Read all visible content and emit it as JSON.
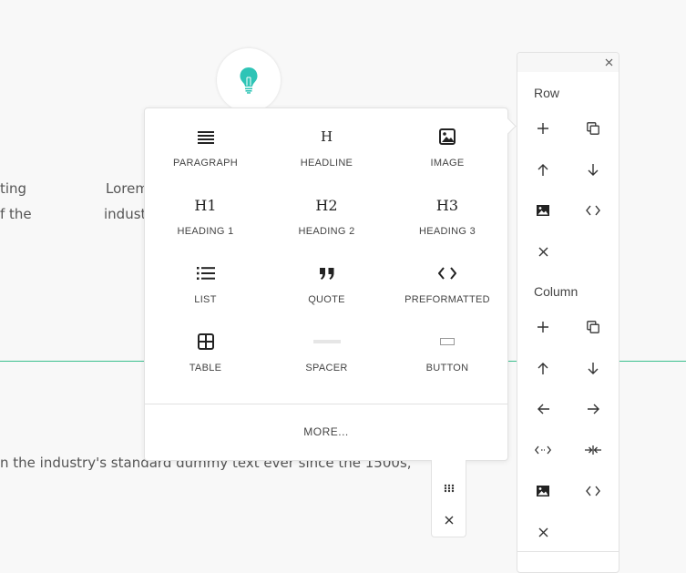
{
  "background": {
    "line1_left": "ting",
    "line2_left": "f the",
    "line1_mid": "Lorem",
    "line2_mid": "indust",
    "line3": "n the industry's standard dummy text ever since the 1500s,"
  },
  "block_picker": {
    "items": [
      {
        "label": "PARAGRAPH",
        "icon": "paragraph-icon"
      },
      {
        "label": "HEADLINE",
        "icon": "headline-icon",
        "glyph": "H"
      },
      {
        "label": "IMAGE",
        "icon": "image-icon"
      },
      {
        "label": "HEADING 1",
        "icon": "heading-1-icon",
        "glyph": "H1"
      },
      {
        "label": "HEADING 2",
        "icon": "heading-2-icon",
        "glyph": "H2"
      },
      {
        "label": "HEADING 3",
        "icon": "heading-3-icon",
        "glyph": "H3"
      },
      {
        "label": "LIST",
        "icon": "list-icon"
      },
      {
        "label": "QUOTE",
        "icon": "quote-icon"
      },
      {
        "label": "PREFORMATTED",
        "icon": "code-icon"
      },
      {
        "label": "TABLE",
        "icon": "table-icon"
      },
      {
        "label": "SPACER",
        "icon": "spacer-icon"
      },
      {
        "label": "BUTTON",
        "icon": "button-icon"
      }
    ],
    "more_label": "MORE..."
  },
  "side_panel": {
    "row_title": "Row",
    "column_title": "Column"
  },
  "colors": {
    "accent": "#2ec4b6",
    "divider_line": "#3bbf8e"
  }
}
